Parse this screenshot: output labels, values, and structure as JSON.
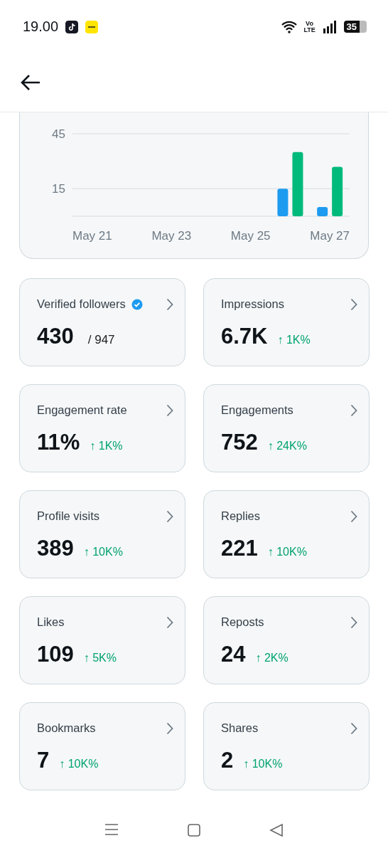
{
  "status_bar": {
    "time": "19.00",
    "network": "Vo LTE",
    "battery": "35"
  },
  "chart": {
    "chart_data": {
      "type": "bar",
      "categories": [
        "May 21",
        null,
        "May 23",
        null,
        "May 25",
        null,
        "May 27"
      ],
      "ylim": [
        0,
        45
      ],
      "yticks": [
        15,
        45
      ],
      "series": [
        {
          "color": "#1d9bf0",
          "values": [
            null,
            null,
            null,
            null,
            null,
            15,
            5
          ]
        },
        {
          "color": "#00ba7c",
          "values": [
            null,
            null,
            null,
            null,
            null,
            35,
            27
          ]
        }
      ]
    }
  },
  "metrics": [
    {
      "label": "Verified followers",
      "verified": true,
      "value": "430",
      "total": "/ 947"
    },
    {
      "label": "Impressions",
      "value": "6.7K",
      "change": "↑ 1K%"
    },
    {
      "label": "Engagement rate",
      "value": "11%",
      "change": "↑ 1K%"
    },
    {
      "label": "Engagements",
      "value": "752",
      "change": "↑ 24K%"
    },
    {
      "label": "Profile visits",
      "value": "389",
      "change": "↑ 10K%"
    },
    {
      "label": "Replies",
      "value": "221",
      "change": "↑ 10K%"
    },
    {
      "label": "Likes",
      "value": "109",
      "change": "↑ 5K%"
    },
    {
      "label": "Reposts",
      "value": "24",
      "change": "↑ 2K%"
    },
    {
      "label": "Bookmarks",
      "value": "7",
      "change": "↑ 10K%"
    },
    {
      "label": "Shares",
      "value": "2",
      "change": "↑ 10K%"
    }
  ]
}
